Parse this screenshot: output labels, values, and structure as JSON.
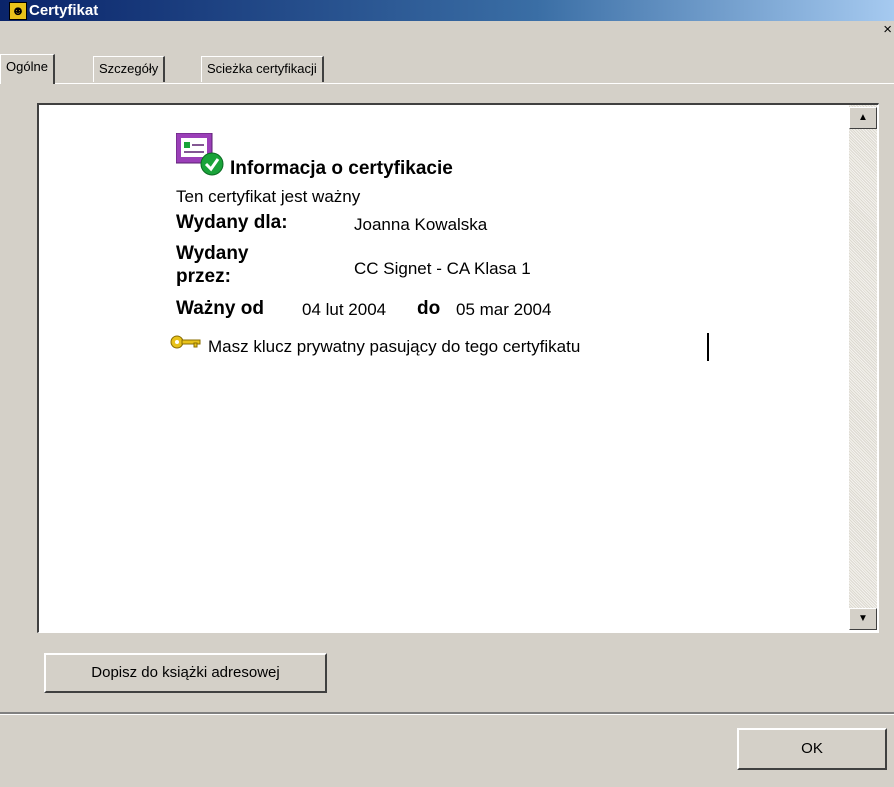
{
  "window": {
    "title": "Certyfikat",
    "close_glyph": "×"
  },
  "tabs": [
    {
      "label": "Ogólne",
      "active": true
    },
    {
      "label": "Szczegóły",
      "active": false
    },
    {
      "label": "Scieżka certyfikacji",
      "active": false
    }
  ],
  "info": {
    "heading": "Informacja o certyfikacie",
    "status": "Ten certyfikat jest ważny",
    "issued_to_label": "Wydany dla:",
    "issued_to_value": "Joanna Kowalska",
    "issued_by_label_line1": "Wydany",
    "issued_by_label_line2": "przez:",
    "issued_by_value": "CC Signet - CA Klasa 1",
    "valid_from_label": "Ważny od",
    "valid_from_value": "04 lut 2004",
    "valid_to_label": "do",
    "valid_to_value": "05 mar 2004",
    "private_key_text": "Masz klucz prywatny pasujący do tego certyfikatu"
  },
  "buttons": {
    "address_book": "Dopisz do książki adresowej",
    "ok": "OK"
  },
  "colors": {
    "titlebar_start": "#0a246a",
    "titlebar_end": "#a6caf0",
    "dialog_bg": "#d4d0c8",
    "cert_icon_purple": "#9b3fb8",
    "check_green": "#1aa33a",
    "key_yellow": "#e8c21a"
  }
}
